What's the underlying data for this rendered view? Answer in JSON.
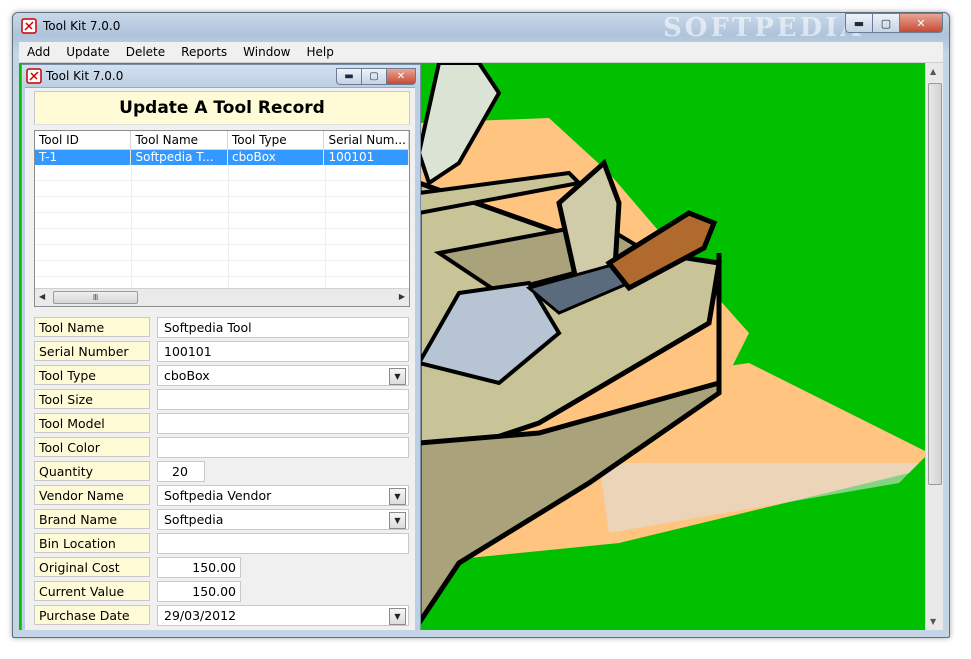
{
  "app": {
    "title": "Tool Kit  7.0.0",
    "watermark": "SOFTPEDIA"
  },
  "window_controls": {
    "minimize": "▬",
    "maximize": "▢",
    "close": "✕"
  },
  "menu": [
    "Add",
    "Update",
    "Delete",
    "Reports",
    "Window",
    "Help"
  ],
  "child": {
    "title": "Tool Kit  7.0.0",
    "form_title": "Update A Tool Record"
  },
  "list": {
    "columns": [
      "Tool ID",
      "Tool Name",
      "Tool Type",
      "Serial Num..."
    ],
    "rows": [
      [
        "T-1",
        "Softpedia T...",
        "cboBox",
        "100101"
      ]
    ]
  },
  "fields": [
    {
      "label": "Tool Name",
      "value": "Softpedia Tool",
      "kind": "text"
    },
    {
      "label": "Serial Number",
      "value": "100101",
      "kind": "text"
    },
    {
      "label": "Tool Type",
      "value": "cboBox",
      "kind": "select"
    },
    {
      "label": "Tool Size",
      "value": "",
      "kind": "text"
    },
    {
      "label": "Tool Model",
      "value": "",
      "kind": "text"
    },
    {
      "label": "Tool Color",
      "value": "",
      "kind": "text"
    },
    {
      "label": "Quantity",
      "value": "20",
      "kind": "short"
    },
    {
      "label": "Vendor Name",
      "value": "Softpedia Vendor",
      "kind": "select"
    },
    {
      "label": "Brand Name",
      "value": "Softpedia",
      "kind": "select"
    },
    {
      "label": "Bin Location",
      "value": "",
      "kind": "text"
    },
    {
      "label": "Original Cost",
      "value": "150.00",
      "kind": "money"
    },
    {
      "label": "Current Value",
      "value": "150.00",
      "kind": "money"
    },
    {
      "label": "Purchase Date",
      "value": "29/03/2012",
      "kind": "select"
    }
  ],
  "colors": {
    "client_bg": "#00c000",
    "label_bg": "#fffbd6",
    "selection": "#3399ff"
  }
}
